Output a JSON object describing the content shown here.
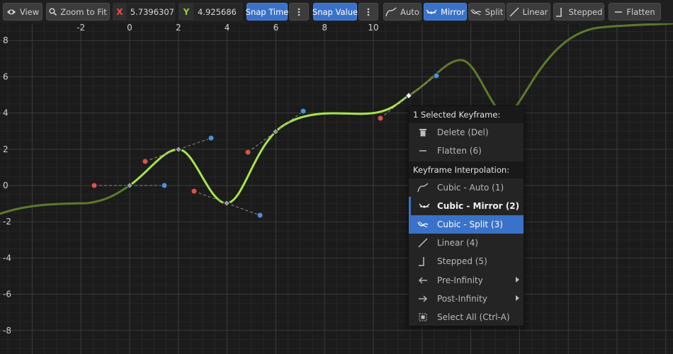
{
  "toolbar": {
    "view_label": "View",
    "zoom_label": "Zoom to Fit",
    "x_tag": "X",
    "x_value": "5.7396307",
    "y_tag": "Y",
    "y_value": "4.925686",
    "snap_time_label": "Snap Time",
    "snap_value_label": "Snap Value",
    "auto_label": "Auto",
    "mirror_label": "Mirror",
    "split_label": "Split",
    "linear_label": "Linear",
    "stepped_label": "Stepped",
    "flatten_label": "Flatten",
    "icons": [
      "eye-icon",
      "magnifier-icon",
      "kebab-icon",
      "auto-tangent-icon",
      "mirror-tangent-icon",
      "split-tangent-icon",
      "linear-icon",
      "stepped-icon",
      "flatten-icon"
    ]
  },
  "colors": {
    "accent": "#3a72c9",
    "curve_selected": "#a6e44a",
    "curve_dim": "#5d7a2c",
    "x_tag": "#e8504a",
    "y_tag": "#9ccc3c",
    "in_tangent": "#d9534f",
    "out_tangent": "#4f8fd9"
  },
  "graph": {
    "x_labels": [
      {
        "value": -2,
        "label": "-2"
      },
      {
        "value": 0,
        "label": "0"
      },
      {
        "value": 2,
        "label": "2"
      },
      {
        "value": 4,
        "label": "4"
      },
      {
        "value": 6,
        "label": "6"
      },
      {
        "value": 8,
        "label": "8"
      },
      {
        "value": 10,
        "label": "10"
      }
    ],
    "y_labels": [
      {
        "value": 8,
        "label": "8"
      },
      {
        "value": 6,
        "label": "6"
      },
      {
        "value": 4,
        "label": "4"
      },
      {
        "value": 2,
        "label": "2"
      },
      {
        "value": 0,
        "label": "0"
      },
      {
        "value": -2,
        "label": "-2"
      },
      {
        "value": -4,
        "label": "-4"
      },
      {
        "value": -6,
        "label": "-6"
      },
      {
        "value": -8,
        "label": "-8"
      }
    ],
    "keyframes": [
      {
        "x": 0,
        "y": 0,
        "in": [
          -1.45,
          0
        ],
        "out": [
          1.45,
          0
        ],
        "selected": false
      },
      {
        "x": 2.0,
        "y": 2.0,
        "in": [
          0.3,
          1.3
        ],
        "out": [
          3.4,
          2.6
        ],
        "selected": false
      },
      {
        "x": 4.0,
        "y": -0.9,
        "in": [
          2.65,
          -0.3
        ],
        "out": [
          5.35,
          -1.6
        ],
        "selected": false
      },
      {
        "x": 6.05,
        "y": 3.0,
        "in": [
          4.9,
          1.8
        ],
        "out": [
          7.15,
          4.2
        ],
        "selected": false
      },
      {
        "x": 11.5,
        "y": 4.9,
        "in": [
          10.4,
          3.8
        ],
        "out": [
          12.6,
          6.1
        ],
        "selected": true
      }
    ]
  },
  "menu": {
    "section1_title": "1 Selected Keyframe:",
    "section2_title": "Keyframe Interpolation:",
    "items": [
      {
        "label": "Delete (Del)",
        "icon": "trash-icon"
      },
      {
        "label": "Flatten (6)",
        "icon": "flatten-icon"
      },
      {
        "label": "Cubic - Auto (1)",
        "icon": "auto-tangent-icon"
      },
      {
        "label": "Cubic - Mirror (2)",
        "icon": "mirror-tangent-icon"
      },
      {
        "label": "Cubic - Split (3)",
        "icon": "split-tangent-icon"
      },
      {
        "label": "Linear (4)",
        "icon": "linear-icon"
      },
      {
        "label": "Stepped (5)",
        "icon": "stepped-icon"
      },
      {
        "label": "Pre-Infinity",
        "icon": "arrow-left-icon"
      },
      {
        "label": "Post-Infinity",
        "icon": "arrow-right-icon"
      },
      {
        "label": "Select All (Ctrl-A)",
        "icon": "select-all-icon"
      }
    ]
  }
}
